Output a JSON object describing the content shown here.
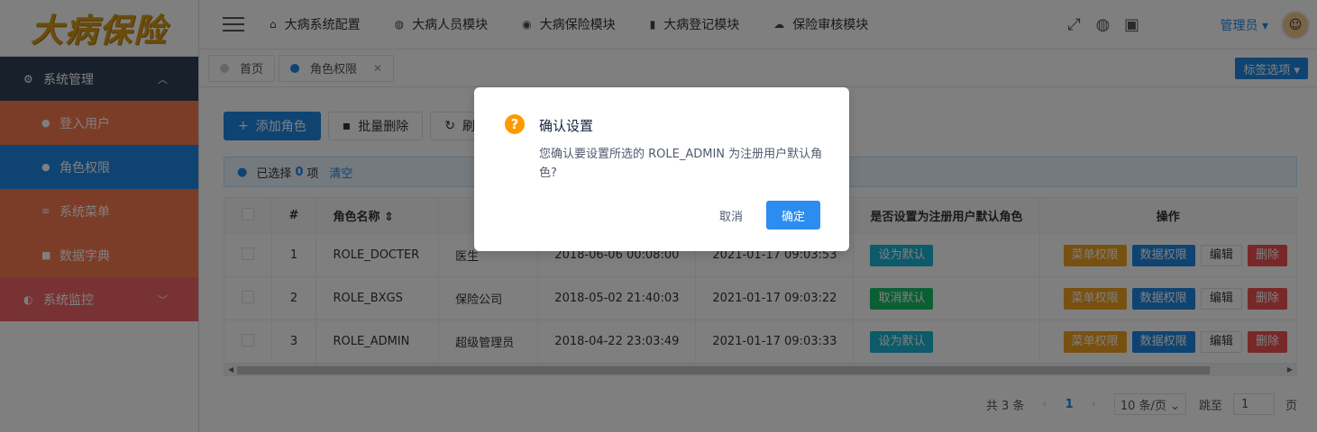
{
  "app": {
    "logo_text": "大病保险"
  },
  "sidebar": {
    "groups": [
      {
        "label": "系统管理",
        "icon": "gear-icon"
      },
      {
        "label": "系统监控",
        "icon": "monitor-icon"
      }
    ],
    "items": [
      {
        "label": "登入用户",
        "icon": "user-icon"
      },
      {
        "label": "角色权限",
        "icon": "users-icon"
      },
      {
        "label": "系统菜单",
        "icon": "menu-icon"
      },
      {
        "label": "数据字典",
        "icon": "book-icon"
      }
    ]
  },
  "topbar": {
    "nav": [
      {
        "label": "大病系统配置",
        "icon": "home-icon"
      },
      {
        "label": "大病人员模块",
        "icon": "globe-icon"
      },
      {
        "label": "大病保险模块",
        "icon": "record-icon"
      },
      {
        "label": "大病登记模块",
        "icon": "book-icon"
      },
      {
        "label": "保险审核模块",
        "icon": "cloud-icon"
      }
    ],
    "user": "管理员"
  },
  "tabs": {
    "items": [
      {
        "label": "首页"
      },
      {
        "label": "角色权限"
      }
    ],
    "options_label": "标签选项 ▾"
  },
  "toolbar": {
    "add_label": "添加角色",
    "batch_delete_label": "批量删除",
    "refresh_label": "刷新"
  },
  "selection": {
    "prefix": "已选择",
    "count": "0",
    "suffix": "项",
    "clear": "清空"
  },
  "table": {
    "headers": {
      "index": "#",
      "name": "角色名称 ⇕",
      "desc": "",
      "created": "",
      "updated": "",
      "default": "是否设置为注册用户默认角色",
      "actions": "操作"
    },
    "rows": [
      {
        "index": "1",
        "name": "ROLE_DOCTER",
        "desc": "医生",
        "created": "2018-06-06 00:08:00",
        "updated": "2021-01-17 09:03:53",
        "default_btn": "设为默认"
      },
      {
        "index": "2",
        "name": "ROLE_BXGS",
        "desc": "保险公司",
        "created": "2018-05-02 21:40:03",
        "updated": "2021-01-17 09:03:22",
        "default_btn": "取消默认"
      },
      {
        "index": "3",
        "name": "ROLE_ADMIN",
        "desc": "超级管理员",
        "created": "2018-04-22 23:03:49",
        "updated": "2021-01-17 09:03:33",
        "default_btn": "设为默认"
      }
    ],
    "action_labels": {
      "menu_perm": "菜单权限",
      "data_perm": "数据权限",
      "edit": "编辑",
      "delete": "删除"
    }
  },
  "pagination": {
    "total": "共 3 条",
    "current_page": "1",
    "page_size": "10 条/页 ⌄",
    "jump_label": "跳至",
    "jump_value": "1",
    "page_suffix": "页"
  },
  "dialog": {
    "title": "确认设置",
    "message": "您确认要设置所选的 ROLE_ADMIN 为注册用户默认角色?",
    "cancel_label": "取消",
    "ok_label": "确定"
  },
  "colors": {
    "primary": "#1e88e5",
    "warning": "#ff9900",
    "sidebar_dark": "#304156"
  }
}
